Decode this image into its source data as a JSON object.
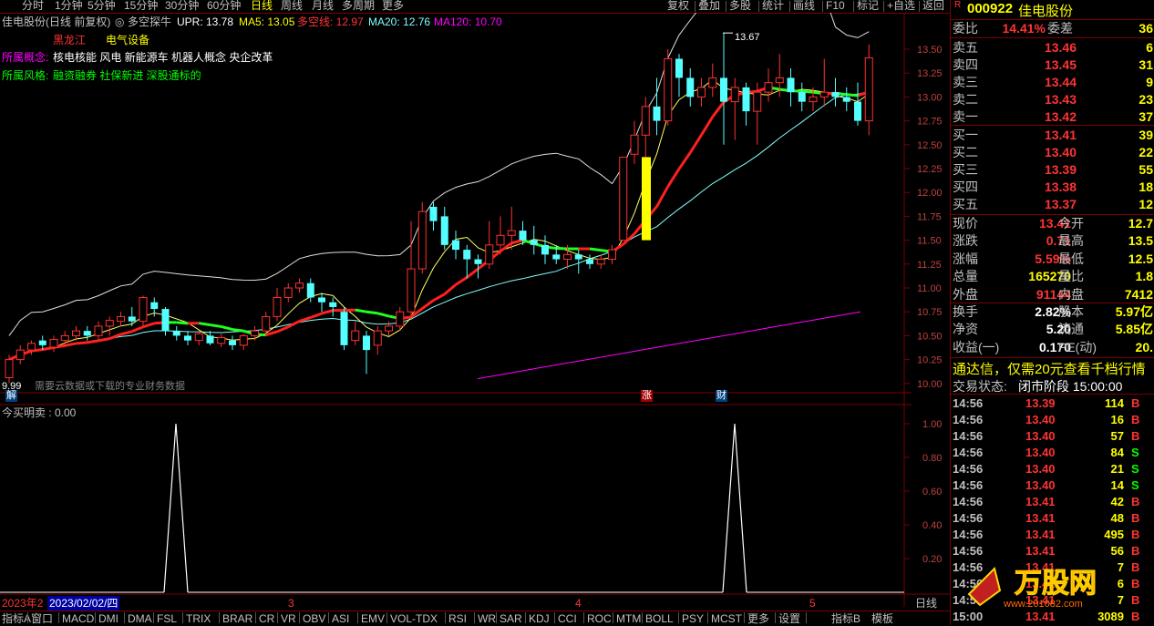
{
  "topbar": {
    "timeframes": [
      "分时",
      "1分钟",
      "5分钟",
      "15分钟",
      "30分钟",
      "60分钟",
      "日线",
      "周线",
      "月线",
      "多周期",
      "更多"
    ],
    "active": "日线",
    "buttons": [
      "复权",
      "叠加",
      "多股",
      "统计",
      "画线",
      "F10",
      "标记",
      "+自选",
      "返回"
    ]
  },
  "header": {
    "stock": "佳电股份(日线 前复权)",
    "indicator_name": "多空探牛",
    "upr": "UPR: 13.78",
    "ma5": "MA5: 13.05",
    "duokong": "多空线: 12.97",
    "ma20": "MA20: 12.76",
    "ma120": "MA120: 10.70",
    "region": "黑龙江",
    "industry": "电气设备",
    "concept_label": "所属概念:",
    "concepts": "核电核能 风电 新能源车 机器人概念 央企改革",
    "style_label": "所属风格:",
    "styles": "融资融券 社保新进 深股通标的"
  },
  "main_chart": {
    "high_marker": "13.67",
    "low_marker": "9.99",
    "hint": "需要云数据或下载的专业财务数据",
    "badges": [
      "解",
      "涨",
      "财"
    ],
    "y_ticks": [
      "13.50",
      "13.25",
      "13.00",
      "12.75",
      "12.50",
      "12.25",
      "12.00",
      "11.75",
      "11.50",
      "11.25",
      "11.00",
      "10.75",
      "10.50",
      "10.25",
      "10.00"
    ],
    "candles": [
      [
        10.06,
        10.25,
        10.0,
        10.3
      ],
      [
        10.25,
        10.35,
        10.2,
        10.4
      ],
      [
        10.35,
        10.42,
        10.3,
        10.45
      ],
      [
        10.45,
        10.4,
        10.35,
        10.5
      ],
      [
        10.38,
        10.46,
        10.33,
        10.5
      ],
      [
        10.45,
        10.5,
        10.4,
        10.55
      ],
      [
        10.5,
        10.55,
        10.45,
        10.6
      ],
      [
        10.55,
        10.5,
        10.45,
        10.6
      ],
      [
        10.5,
        10.6,
        10.45,
        10.65
      ],
      [
        10.6,
        10.66,
        10.5,
        10.7
      ],
      [
        10.65,
        10.7,
        10.6,
        10.75
      ],
      [
        10.7,
        10.65,
        10.6,
        10.8
      ],
      [
        10.65,
        10.9,
        10.6,
        10.92
      ],
      [
        10.85,
        10.78,
        10.7,
        10.9
      ],
      [
        10.78,
        10.55,
        10.5,
        10.8
      ],
      [
        10.55,
        10.5,
        10.45,
        10.6
      ],
      [
        10.5,
        10.45,
        10.4,
        10.55
      ],
      [
        10.45,
        10.52,
        10.4,
        10.55
      ],
      [
        10.5,
        10.42,
        10.4,
        10.55
      ],
      [
        10.42,
        10.48,
        10.38,
        10.52
      ],
      [
        10.45,
        10.4,
        10.35,
        10.5
      ],
      [
        10.4,
        10.5,
        10.35,
        10.52
      ],
      [
        10.5,
        10.55,
        10.45,
        10.6
      ],
      [
        10.55,
        10.7,
        10.5,
        10.75
      ],
      [
        10.7,
        10.9,
        10.65,
        11.0
      ],
      [
        10.9,
        11.0,
        10.85,
        11.05
      ],
      [
        11.0,
        11.05,
        10.95,
        11.1
      ],
      [
        11.05,
        10.9,
        10.85,
        11.1
      ],
      [
        10.9,
        10.85,
        10.75,
        10.95
      ],
      [
        10.85,
        10.8,
        10.7,
        10.9
      ],
      [
        10.75,
        10.4,
        10.35,
        10.8
      ],
      [
        10.45,
        10.55,
        10.4,
        10.65
      ],
      [
        10.5,
        10.35,
        10.1,
        10.55
      ],
      [
        10.4,
        10.55,
        10.3,
        10.6
      ],
      [
        10.55,
        10.6,
        10.5,
        10.65
      ],
      [
        10.6,
        10.75,
        10.55,
        10.8
      ],
      [
        10.75,
        11.2,
        10.7,
        11.7
      ],
      [
        11.2,
        11.8,
        11.15,
        11.9
      ],
      [
        11.85,
        11.7,
        11.6,
        11.9
      ],
      [
        11.75,
        11.45,
        11.4,
        11.85
      ],
      [
        11.5,
        11.4,
        11.3,
        11.6
      ],
      [
        11.4,
        11.3,
        11.1,
        11.45
      ],
      [
        11.3,
        11.25,
        11.1,
        11.35
      ],
      [
        11.25,
        11.45,
        11.2,
        11.7
      ],
      [
        11.45,
        11.55,
        11.35,
        11.75
      ],
      [
        11.55,
        11.6,
        11.4,
        11.85
      ],
      [
        11.6,
        11.5,
        11.45,
        11.7
      ],
      [
        11.5,
        11.45,
        11.35,
        11.65
      ],
      [
        11.45,
        11.35,
        11.25,
        11.55
      ],
      [
        11.35,
        11.3,
        11.25,
        11.45
      ],
      [
        11.3,
        11.35,
        11.2,
        11.45
      ],
      [
        11.35,
        11.3,
        11.15,
        11.4
      ],
      [
        11.3,
        11.25,
        11.2,
        11.35
      ],
      [
        11.25,
        11.3,
        11.2,
        11.35
      ],
      [
        11.3,
        11.4,
        11.25,
        11.45
      ],
      [
        11.5,
        12.37,
        11.5,
        12.37
      ],
      [
        12.4,
        12.6,
        12.3,
        12.75
      ],
      [
        12.6,
        12.9,
        12.2,
        13.0
      ],
      [
        12.9,
        12.75,
        12.6,
        13.2
      ],
      [
        12.75,
        13.4,
        12.7,
        13.5
      ],
      [
        13.4,
        13.2,
        13.0,
        13.45
      ],
      [
        13.2,
        13.0,
        12.9,
        13.3
      ],
      [
        13.0,
        13.1,
        12.9,
        13.2
      ],
      [
        13.1,
        13.2,
        13.0,
        13.35
      ],
      [
        13.2,
        12.95,
        12.5,
        13.67
      ],
      [
        12.95,
        13.1,
        12.55,
        13.2
      ],
      [
        13.1,
        12.85,
        12.7,
        13.15
      ],
      [
        12.85,
        13.05,
        12.5,
        13.15
      ],
      [
        13.05,
        13.15,
        12.95,
        13.3
      ],
      [
        13.15,
        13.2,
        13.0,
        13.45
      ],
      [
        13.2,
        13.05,
        12.9,
        13.3
      ],
      [
        13.05,
        12.95,
        12.85,
        13.15
      ],
      [
        12.95,
        13.0,
        12.85,
        13.1
      ],
      [
        13.0,
        13.05,
        12.9,
        13.4
      ],
      [
        13.05,
        13.0,
        12.9,
        13.2
      ],
      [
        13.0,
        12.95,
        12.85,
        13.1
      ],
      [
        12.95,
        12.75,
        12.7,
        13.15
      ],
      [
        12.75,
        13.41,
        12.6,
        13.55
      ]
    ]
  },
  "sub_chart": {
    "title": "今买明卖 : 0.00",
    "y_ticks": [
      "1.00",
      "0.80",
      "0.60",
      "0.40",
      "0.20"
    ],
    "spikes": [
      193,
      806
    ]
  },
  "date_axis": {
    "year": "2023年2",
    "cursor": "2023/02/02/四",
    "months": [
      "3",
      "4",
      "5"
    ],
    "period": "日线"
  },
  "bottom_tabs": [
    "指标A",
    "窗口",
    "MACD",
    "DMI",
    "DMA",
    "FSL",
    "TRIX",
    "BRAR",
    "CR",
    "VR",
    "OBV",
    "ASI",
    "EMV",
    "VOL-TDX",
    "RSI",
    "WR",
    "SAR",
    "KDJ",
    "CCI",
    "ROC",
    "MTM",
    "BOLL",
    "PSY",
    "MCST",
    "更多",
    "设置"
  ],
  "bottom_right": [
    "指标B",
    "模板"
  ],
  "quote": {
    "code": "000922",
    "name": "佳电股份",
    "weibi_label": "委比",
    "weibi": "14.41%",
    "weicha_label": "委差",
    "weicha": "36",
    "asks": [
      {
        "label": "卖五",
        "price": "13.46",
        "vol": "6"
      },
      {
        "label": "卖四",
        "price": "13.45",
        "vol": "31"
      },
      {
        "label": "卖三",
        "price": "13.44",
        "vol": "9"
      },
      {
        "label": "卖二",
        "price": "13.43",
        "vol": "23"
      },
      {
        "label": "卖一",
        "price": "13.42",
        "vol": "37"
      }
    ],
    "bids": [
      {
        "label": "买一",
        "price": "13.41",
        "vol": "39"
      },
      {
        "label": "买二",
        "price": "13.40",
        "vol": "22"
      },
      {
        "label": "买三",
        "price": "13.39",
        "vol": "55"
      },
      {
        "label": "买四",
        "price": "13.38",
        "vol": "18"
      },
      {
        "label": "买五",
        "price": "13.37",
        "vol": "12"
      }
    ],
    "stats": [
      {
        "l1": "现价",
        "v1": "13.41",
        "l2": "今开",
        "v2": "12.7"
      },
      {
        "l1": "涨跌",
        "v1": "0.71",
        "l2": "最高",
        "v2": "13.5"
      },
      {
        "l1": "涨幅",
        "v1": "5.59%",
        "l2": "最低",
        "v2": "12.5"
      },
      {
        "l1": "总量",
        "v1": "165270",
        "l2": "量比",
        "v2": "1.8"
      },
      {
        "l1": "外盘",
        "v1": "91144",
        "l2": "内盘",
        "v2": "7412"
      }
    ],
    "stats2": [
      {
        "l1": "换手",
        "v1": "2.82%",
        "l2": "股本",
        "v2": "5.97亿"
      },
      {
        "l1": "净资",
        "v1": "5.20",
        "l2": "流通",
        "v2": "5.85亿"
      },
      {
        "l1": "收益(一)",
        "v1": "0.170",
        "l2": "PE(动)",
        "v2": "20."
      }
    ],
    "promo": "通达信，仅需20元查看千档行情",
    "status_label": "交易状态:",
    "status": "闭市阶段 15:00:00",
    "ticks": [
      {
        "t": "14:56",
        "p": "13.39",
        "q": "114",
        "s": "B"
      },
      {
        "t": "14:56",
        "p": "13.40",
        "q": "16",
        "s": "B"
      },
      {
        "t": "14:56",
        "p": "13.40",
        "q": "57",
        "s": "B"
      },
      {
        "t": "14:56",
        "p": "13.40",
        "q": "84",
        "s": "S"
      },
      {
        "t": "14:56",
        "p": "13.40",
        "q": "21",
        "s": "S"
      },
      {
        "t": "14:56",
        "p": "13.40",
        "q": "14",
        "s": "S"
      },
      {
        "t": "14:56",
        "p": "13.41",
        "q": "42",
        "s": "B"
      },
      {
        "t": "14:56",
        "p": "13.41",
        "q": "48",
        "s": "B"
      },
      {
        "t": "14:56",
        "p": "13.41",
        "q": "495",
        "s": "B"
      },
      {
        "t": "14:56",
        "p": "13.41",
        "q": "56",
        "s": "B"
      },
      {
        "t": "14:56",
        "p": "13.41",
        "q": "7",
        "s": "B"
      },
      {
        "t": "14:56",
        "p": "13.41",
        "q": "6",
        "s": "B"
      },
      {
        "t": "14:56",
        "p": "13.41",
        "q": "7",
        "s": "B"
      },
      {
        "t": "15:00",
        "p": "13.41",
        "q": "3089",
        "s": "B"
      }
    ],
    "watermark": "万股网",
    "watermark_url": "www.201082.com"
  }
}
